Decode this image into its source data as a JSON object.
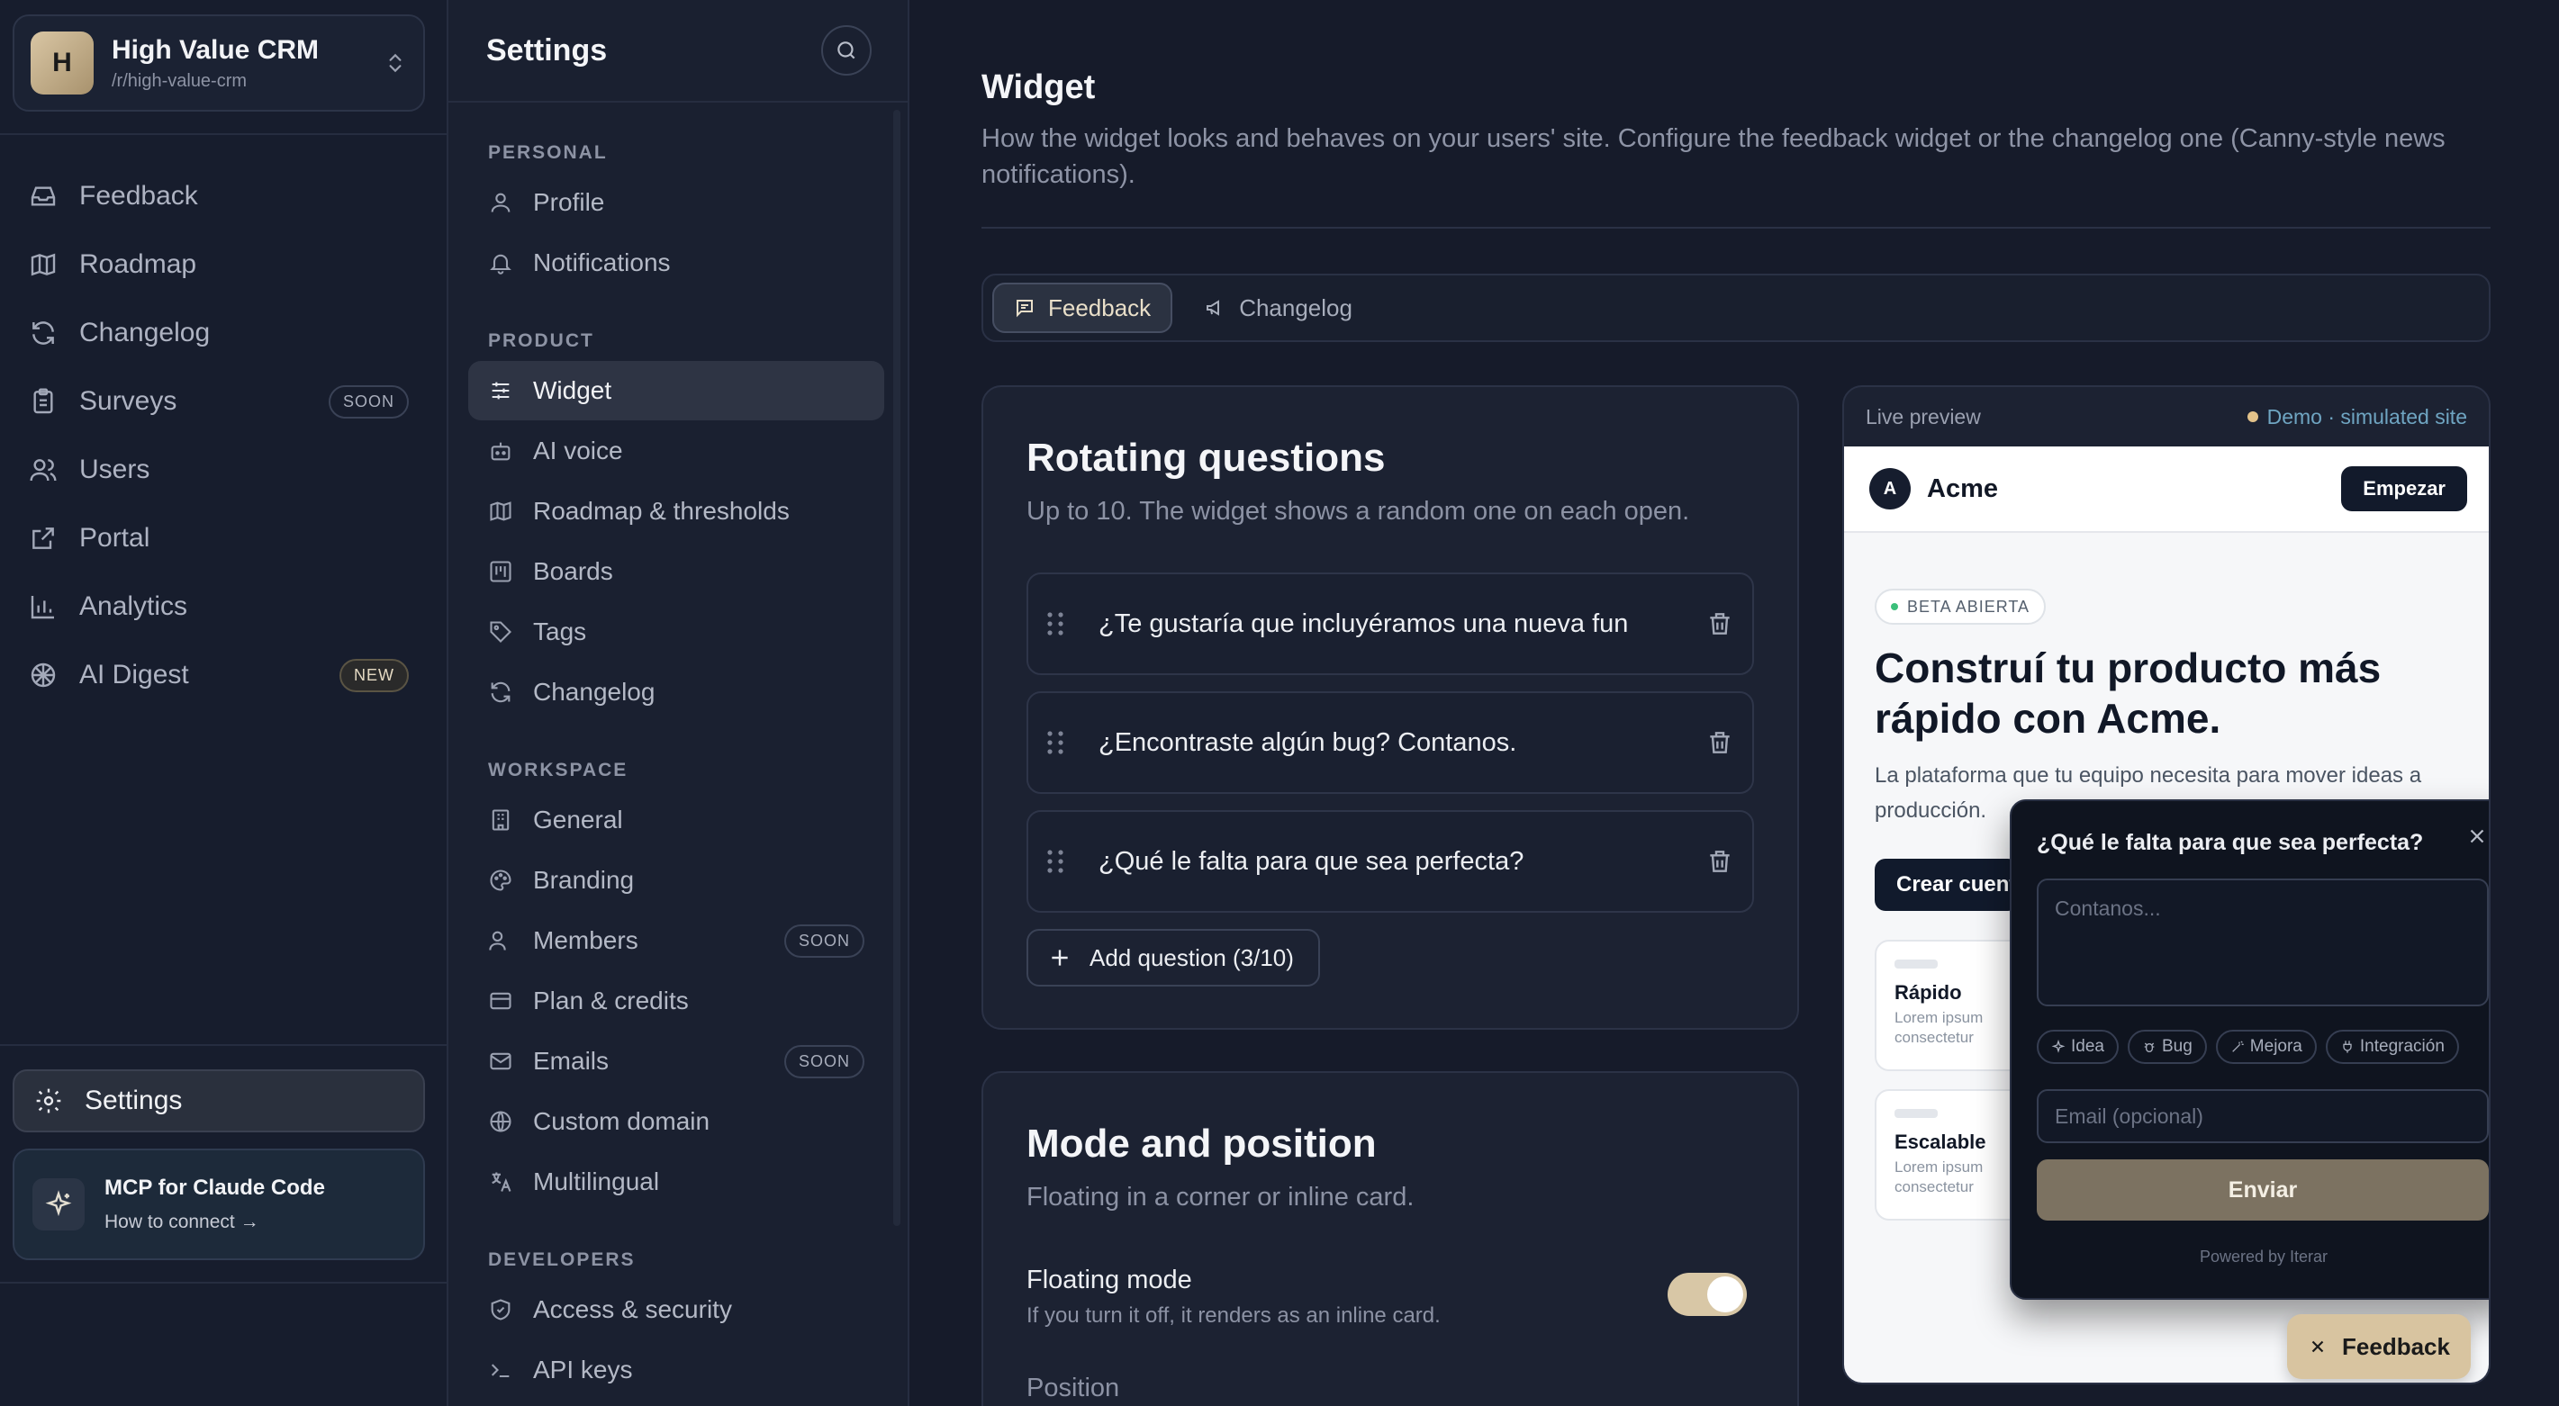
{
  "workspace": {
    "initial": "H",
    "name": "High Value CRM",
    "slug": "/r/high-value-crm"
  },
  "nav": [
    {
      "label": "Feedback",
      "icon": "inbox-icon"
    },
    {
      "label": "Roadmap",
      "icon": "map-icon"
    },
    {
      "label": "Changelog",
      "icon": "refresh-icon"
    },
    {
      "label": "Surveys",
      "icon": "clipboard-icon",
      "badge": "SOON"
    },
    {
      "label": "Users",
      "icon": "users-icon"
    },
    {
      "label": "Portal",
      "icon": "external-link-icon"
    },
    {
      "label": "Analytics",
      "icon": "bar-chart-icon"
    },
    {
      "label": "AI Digest",
      "icon": "brain-icon",
      "badge": "NEW"
    }
  ],
  "settings_button": "Settings",
  "mcp": {
    "title": "MCP for Claude Code",
    "link": "How to connect →"
  },
  "settings": {
    "title": "Settings",
    "sections": {
      "personal": "PERSONAL",
      "product": "PRODUCT",
      "workspace": "WORKSPACE",
      "developers": "DEVELOPERS"
    },
    "personal_items": [
      "Profile",
      "Notifications"
    ],
    "product_items": [
      "Widget",
      "AI voice",
      "Roadmap & thresholds",
      "Boards",
      "Tags",
      "Changelog"
    ],
    "workspace_items": [
      "General",
      "Branding",
      "Members",
      "Plan & credits",
      "Emails",
      "Custom domain",
      "Multilingual"
    ],
    "developer_items": [
      "Access & security",
      "API keys"
    ],
    "soon": "SOON"
  },
  "main": {
    "title": "Widget",
    "description": "How the widget looks and behaves on your users' site. Configure the feedback widget or the changelog one (Canny-style news notifications).",
    "tabs": [
      "Feedback",
      "Changelog"
    ],
    "rotating": {
      "title": "Rotating questions",
      "subtitle": "Up to 10. The widget shows a random one on each open.",
      "questions": [
        "¿Te gustaría que incluyéramos una nueva fun",
        "¿Encontraste algún bug? Contanos.",
        "¿Qué le falta para que sea perfecta?"
      ],
      "add_label": "Add question (3/10)"
    },
    "mode": {
      "title": "Mode and position",
      "subtitle": "Floating in a corner or inline card.",
      "floating_label": "Floating mode",
      "floating_hint": "If you turn it off, it renders as an inline card.",
      "floating_on": true,
      "position_label": "Position"
    }
  },
  "preview": {
    "label": "Live preview",
    "demo": "Demo · simulated site",
    "site": {
      "logo": "A",
      "brand": "Acme",
      "cta": "Empezar",
      "badge": "BETA ABIERTA",
      "headline": "Construí tu producto más rápido con Acme.",
      "text": "La plataforma que tu equipo necesita para mover ideas a producción.",
      "button": "Crear cuenta",
      "features": [
        {
          "title": "Rápido",
          "desc": "Lorem ipsum consectetur"
        },
        {
          "title": "Escalable",
          "desc": "Lorem ipsum consectetur"
        }
      ]
    },
    "widget": {
      "question": "¿Qué le falta para que sea perfecta?",
      "placeholder": "Contanos...",
      "tags": [
        "Idea",
        "Bug",
        "Mejora",
        "Integración"
      ],
      "email_placeholder": "Email (opcional)",
      "send": "Enviar",
      "powered": "Powered by Iterar"
    },
    "launcher": "Feedback"
  },
  "colors": {
    "accent": "#d8c4a0",
    "background": "#161b2a",
    "send": "#7c7261"
  }
}
